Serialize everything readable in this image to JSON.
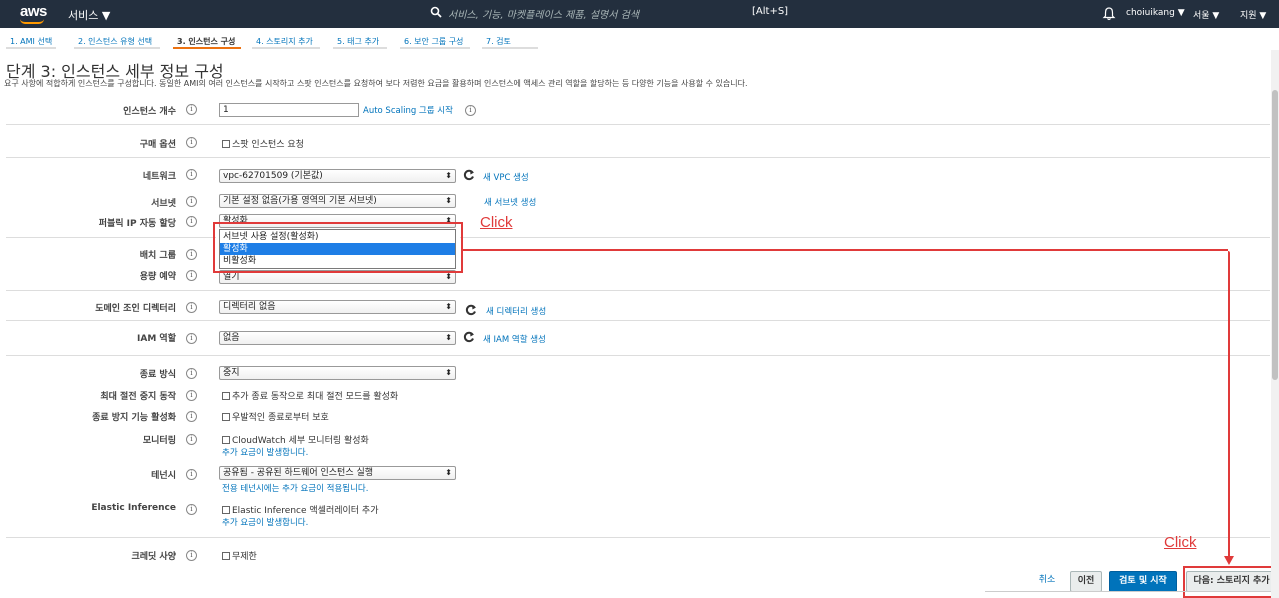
{
  "topbar": {
    "logo": "aws",
    "services": "서비스 ▼",
    "search_placeholder": "서비스, 기능, 마켓플레이스 제품, 설명서 검색",
    "search_shortcut": "[Alt+S]",
    "user": "choiuikang ▼",
    "region": "서울 ▼",
    "support": "지원 ▼"
  },
  "tabs": [
    {
      "label": "1. AMI 선택"
    },
    {
      "label": "2. 인스턴스 유형 선택"
    },
    {
      "label": "3. 인스턴스 구성"
    },
    {
      "label": "4. 스토리지 추가"
    },
    {
      "label": "5. 태그 추가"
    },
    {
      "label": "6. 보안 그룹 구성"
    },
    {
      "label": "7. 검토"
    }
  ],
  "page": {
    "title": "단계 3: 인스턴스 세부 정보 구성",
    "description": "요구 사항에 적합하게 인스턴스를 구성합니다. 동일한 AMI의 여러 인스턴스를 시작하고 스팟 인스턴스를 요청하여 보다 저렴한 요금을 활용하며 인스턴스에 액세스 관리 역할을 할당하는 등 다양한 기능을 사용할 수 있습니다."
  },
  "info_symbol": "i",
  "form": {
    "instance_count": {
      "label": "인스턴스 개수",
      "value": "1",
      "link": "Auto Scaling 그룹 시작"
    },
    "purchase_option": {
      "label": "구매 옵션",
      "checkbox": "스팟 인스턴스 요청"
    },
    "network": {
      "label": "네트워크",
      "value": "vpc-62701509 (기본값)",
      "link": "새 VPC 생성"
    },
    "subnet": {
      "label": "서브넷",
      "value": "기본 설정 없음(가용 영역의 기본 서브넷)",
      "link": "새 서브넷 생성"
    },
    "public_ip": {
      "label": "퍼블릭 IP 자동 할당",
      "value": "활성화",
      "options": [
        "서브넷 사용 설정(활성화)",
        "활성화",
        "비활성화"
      ]
    },
    "placement_group": {
      "label": "배치 그룹"
    },
    "capacity": {
      "label": "용량 예약",
      "value": "열기"
    },
    "domain": {
      "label": "도메인 조인 디렉터리",
      "value": "디렉터리 없음",
      "link": "새 디렉터리 생성"
    },
    "iam": {
      "label": "IAM 역할",
      "value": "없음",
      "link": "새 IAM 역할 생성"
    },
    "shutdown": {
      "label": "종료 방식",
      "value": "중지"
    },
    "hibernate": {
      "label": "최대 절전 중지 동작",
      "checkbox": "추가 종료 동작으로 최대 절전 모드를 활성화"
    },
    "termination": {
      "label": "종료 방지 기능 활성화",
      "checkbox": "우발적인 종료로부터 보호"
    },
    "monitoring": {
      "label": "모니터링",
      "checkbox": "CloudWatch 세부 모니터링 활성화",
      "note": "추가 요금이 발생합니다."
    },
    "tenancy": {
      "label": "테넌시",
      "value": "공유됨 - 공유된 하드웨어 인스턴스 실행",
      "note": "전용 테넌시에는 추가 요금이 적용됩니다."
    },
    "elastic": {
      "label": "Elastic Inference",
      "checkbox": "Elastic Inference 액셀러레이터 추가",
      "note": "추가 요금이 발생합니다."
    },
    "credit": {
      "label": "크레딧 사양",
      "checkbox": "무제한"
    }
  },
  "annotations": {
    "click1": "Click",
    "click2": "Click",
    "color": "#e03a3a"
  },
  "footer": {
    "cancel": "취소",
    "prev": "이전",
    "review": "검토 및 시작",
    "next": "다음: 스토리지 추가"
  },
  "colors": {
    "topbar": "#232f3e",
    "accent": "#ec7211",
    "link": "#0073bb",
    "primary_button": "#0073bb"
  }
}
